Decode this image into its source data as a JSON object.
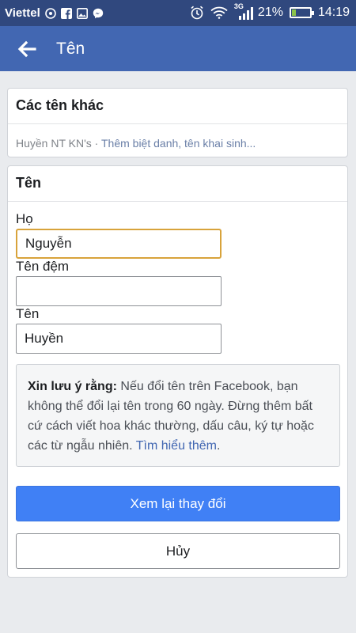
{
  "status_bar": {
    "carrier": "Viettel",
    "network": "3G",
    "battery_percent": "21%",
    "battery_level": 0.21,
    "time": "14:19"
  },
  "app_bar": {
    "title": "Tên",
    "back_icon": "arrow-left-icon"
  },
  "other_names": {
    "heading": "Các tên khác",
    "current": "Huyền NT KN's",
    "separator": " · ",
    "add_link": "Thêm biệt danh, tên khai sinh..."
  },
  "name_form": {
    "heading": "Tên",
    "last_name_label": "Họ",
    "last_name_value": "Nguyễn",
    "middle_name_label": "Tên đệm",
    "middle_name_value": "",
    "first_name_label": "Tên",
    "first_name_value": "Huyền",
    "notice_bold": "Xin lưu ý rằng:",
    "notice_text": " Nếu đổi tên trên Facebook, bạn không thể đổi lại tên trong 60 ngày. Đừng thêm bất cứ cách viết hoa khác thường, dấu câu, ký tự hoặc các từ ngẫu nhiên. ",
    "notice_link": "Tìm hiểu thêm",
    "notice_end": ".",
    "review_button": "Xem lại thay đổi",
    "cancel_button": "Hủy"
  },
  "colors": {
    "status_bar": "#30487e",
    "app_bar": "#4267b2",
    "primary_button": "#4080f5",
    "focus_border": "#d8a33b"
  }
}
